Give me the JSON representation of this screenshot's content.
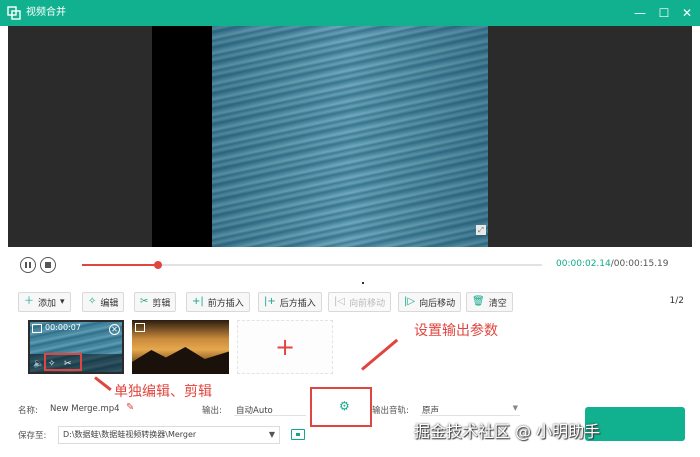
{
  "window": {
    "title": "视频合并",
    "controls": [
      "—",
      "☐",
      "✕"
    ]
  },
  "player": {
    "current_time": "00:00:02.14",
    "total_time": "/00:00:15.19",
    "progress_fraction": 0.166
  },
  "toolbar": {
    "buttons": [
      {
        "icon": "＋",
        "label": "添加",
        "dropdown": "▾",
        "enabled": true
      },
      {
        "icon": "✧",
        "label": "编辑",
        "enabled": true
      },
      {
        "icon": "✂",
        "label": "剪辑",
        "enabled": true
      },
      {
        "icon": "+|",
        "label": "前方插入",
        "enabled": true
      },
      {
        "icon": "|+",
        "label": "后方插入",
        "enabled": true
      },
      {
        "icon": "|◁",
        "label": "向前移动",
        "enabled": false
      },
      {
        "icon": "|▷",
        "label": "向后移动",
        "enabled": true
      },
      {
        "icon": "🗑",
        "label": "清空",
        "enabled": true
      }
    ],
    "page_indicator": "1/2"
  },
  "clips": [
    {
      "time": "00:00:07"
    },
    {
      "time": ""
    }
  ],
  "add_clip_symbol": "+",
  "annotations": {
    "output_settings": "设置输出参数",
    "single_edit": "单独编辑、剪辑"
  },
  "settings": {
    "name_label": "名称:",
    "name_value": "New Merge.mp4",
    "output_label": "输出:",
    "output_value": "自动Auto",
    "audio_label": "输出音轨:",
    "audio_value": "原声",
    "save_label": "保存至:",
    "save_path": "D:\\数据蛙\\数据蛙视频转换器\\Merger"
  },
  "watermark": "掘金技术社区 @ 小明助手",
  "colors": {
    "brand": "#11b08f",
    "accent_red": "#e0463f"
  }
}
